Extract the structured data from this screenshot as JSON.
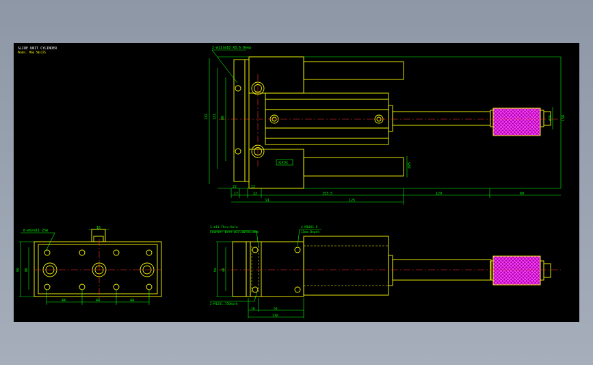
{
  "title_block": {
    "line1": "SLIDE UNIT CYLINDER",
    "line2": "Model: MGG 50x125"
  },
  "top_view": {
    "hole_note": "2-ø11(ø18 X8.6 Deep",
    "dim_overall_height": "132",
    "dim_rail_height": "121",
    "dim_inner_height": "80",
    "dim_base_a": "22",
    "dim_base_b": "17",
    "dim_step_a": "12",
    "dim_step_b": "22",
    "dim_stroke_offset": "91",
    "dim_body_len": "153.5",
    "dim_stroke": "125",
    "dim_rod_len": "129",
    "dim_knob_len": "60",
    "dim_rod_dia": "ø36",
    "dim_knob_height": "158",
    "dim_rod_side": "ø25",
    "badge": "AIRTAC"
  },
  "end_view": {
    "hole_note": "8-ø9/ø11 25æ",
    "dim_top": "16",
    "dim_h1": "99",
    "dim_h2": "86",
    "dim_pitch_1": "44",
    "dim_pitch_2": "44",
    "dim_pitch_3": "44"
  },
  "side_view": {
    "note_top_left_1": "2-ø11 Thru-Hole",
    "note_top_left_2": "Counter bore ø17.5DTO3.8mm",
    "note_top_right_1": "4-M10X1.5",
    "note_top_right_2": "15mm Depth",
    "note_bottom": "2-M12X1.75Depth",
    "dim_h1": "94",
    "dim_h2": "48",
    "dim_a": "10",
    "dim_b": "56",
    "dim_c": "110"
  }
}
